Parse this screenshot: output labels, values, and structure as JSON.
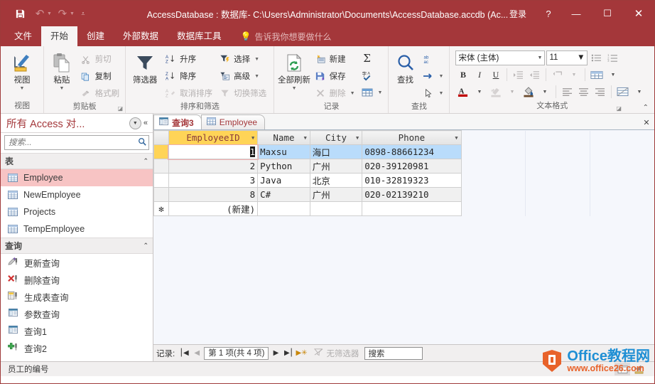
{
  "titlebar": {
    "quick_access": [
      {
        "name": "save",
        "glyph": "💾",
        "label": "保存"
      },
      {
        "name": "undo",
        "glyph": "↶",
        "label": "撤消"
      },
      {
        "name": "redo",
        "glyph": "↷",
        "label": "恢复"
      },
      {
        "name": "customize",
        "glyph": "≡",
        "label": "自定义快速访问工具栏"
      }
    ],
    "title": "AccessDatabase : 数据库- C:\\Users\\Administrator\\Documents\\AccessDatabase.accdb (Ac...",
    "signin": "登录",
    "help": "?",
    "minimize": "—",
    "maximize": "☐",
    "close": "✕"
  },
  "ribbon": {
    "tabs": [
      {
        "label": "文件",
        "active": false
      },
      {
        "label": "开始",
        "active": true
      },
      {
        "label": "创建",
        "active": false
      },
      {
        "label": "外部数据",
        "active": false
      },
      {
        "label": "数据库工具",
        "active": false
      }
    ],
    "tell_me": "告诉我你想要做什么",
    "groups": {
      "view": {
        "label": "视图",
        "button": "视图"
      },
      "clipboard": {
        "label": "剪贴板",
        "paste": "粘贴",
        "cut": "剪切",
        "copy": "复制",
        "format_painter": "格式刷"
      },
      "sort_filter": {
        "label": "排序和筛选",
        "filter": "筛选器",
        "asc": "升序",
        "desc": "降序",
        "clear_sort": "取消排序",
        "selection": "选择",
        "advanced": "高级",
        "toggle_filter": "切换筛选"
      },
      "records": {
        "label": "记录",
        "refresh_all": "全部刷新",
        "new": "新建",
        "save": "保存",
        "delete": "删除"
      },
      "find": {
        "label": "查找",
        "find": "查找",
        "replace": "替换",
        "goto": "转至",
        "select": "选择"
      },
      "text_format": {
        "label": "文本格式",
        "font_name": "宋体 (主体)",
        "font_size": "11",
        "bold": "B",
        "italic": "I",
        "underline": "U"
      }
    }
  },
  "nav_pane": {
    "title": "所有 Access 对...",
    "search_placeholder": "搜索...",
    "groups": [
      {
        "name": "表",
        "items": [
          {
            "label": "Employee",
            "icon": "table-icon",
            "selected": true
          },
          {
            "label": "NewEmployee",
            "icon": "table-icon",
            "selected": false
          },
          {
            "label": "Projects",
            "icon": "table-icon",
            "selected": false
          },
          {
            "label": "TempEmployee",
            "icon": "table-icon",
            "selected": false
          }
        ]
      },
      {
        "name": "查询",
        "items": [
          {
            "label": "更新查询",
            "icon": "update-query-icon",
            "selected": false
          },
          {
            "label": "删除查询",
            "icon": "delete-query-icon",
            "selected": false
          },
          {
            "label": "生成表查询",
            "icon": "maketable-query-icon",
            "selected": false
          },
          {
            "label": "参数查询",
            "icon": "select-query-icon",
            "selected": false
          },
          {
            "label": "查询1",
            "icon": "select-query-icon",
            "selected": false
          },
          {
            "label": "查询2",
            "icon": "append-query-icon",
            "selected": false
          }
        ]
      }
    ]
  },
  "document": {
    "tabs": [
      {
        "label": "查询3",
        "icon": "query-icon",
        "active": true
      },
      {
        "label": "Employee",
        "icon": "table-icon",
        "active": false
      }
    ],
    "close_label": "✕"
  },
  "datasheet": {
    "columns": [
      "EmployeeID",
      "Name",
      "City",
      "Phone"
    ],
    "rows": [
      {
        "EmployeeID": "1",
        "Name": "Maxsu",
        "City": "海口",
        "Phone": "0898-88661234"
      },
      {
        "EmployeeID": "2",
        "Name": "Python",
        "City": "广州",
        "Phone": "020-39120981"
      },
      {
        "EmployeeID": "3",
        "Name": "Java",
        "City": "北京",
        "Phone": "010-32819323"
      },
      {
        "EmployeeID": "8",
        "Name": "C#",
        "City": "广州",
        "Phone": "020-02139210"
      }
    ],
    "new_row_label": "(新建)",
    "new_row_marker": "✻",
    "selected_row_index": 0,
    "key_column": "EmployeeID"
  },
  "record_nav": {
    "label": "记录:",
    "first": "⎮◀",
    "prev": "◀",
    "position": "第 1 项(共 4 项)",
    "next": "▶",
    "last": "▶⎮",
    "new": "▶✳",
    "filter_status": "无筛选器",
    "search_text": "搜索"
  },
  "status_bar": {
    "message": "员工的编号",
    "view_buttons": [
      {
        "name": "datasheet-view",
        "active": true
      },
      {
        "name": "design-view",
        "active": false
      }
    ]
  },
  "watermark": {
    "main": "Office教程网",
    "sub": "www.office26.com"
  },
  "colors": {
    "accent": "#a4373a",
    "ribbon_bg": "#f6f4f4",
    "selected_row": "#b9dcfb",
    "key_header": "#ffd457",
    "nav_selected": "#f7c4c4"
  }
}
